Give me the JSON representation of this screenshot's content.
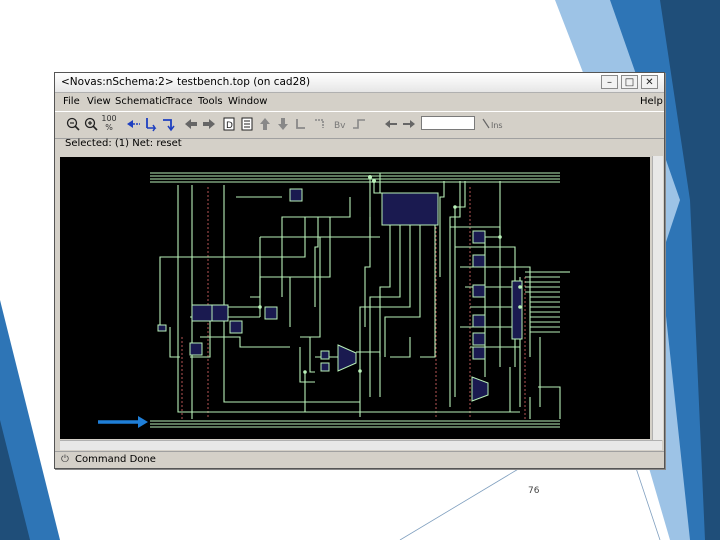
{
  "window": {
    "title": "<Novas:nSchema:2> testbench.top (on cad28)",
    "controls": [
      "–",
      "□",
      "✕"
    ]
  },
  "menu": {
    "file": "File",
    "view": "View",
    "schematic": "Schematic",
    "trace": "Trace",
    "tools": "Tools",
    "window": "Window",
    "help": "Help"
  },
  "toolbar": {
    "zoom_level": "100",
    "zoom_unit": "%",
    "find_placeholder": "",
    "tool_icons": [
      "zoom-out-icon",
      "zoom-in-icon",
      "zoom-fit-icon",
      "trace-driver-icon",
      "trace-load-icon",
      "trace-connect-icon",
      "back-icon",
      "forward-icon",
      "hierarchy-icon",
      "push-icon",
      "up-icon",
      "down-icon",
      "undo-icon",
      "redo-icon",
      "bus-icon",
      "signal-icon",
      "find-prev-icon",
      "find-next-icon",
      "find-icon"
    ]
  },
  "selection": {
    "text": "Selected: (1) Net: reset"
  },
  "status": {
    "text": "Command Done"
  },
  "slide": {
    "page_number": "76",
    "accent_colors": [
      "#1f4e79",
      "#2e75b6",
      "#9dc3e6"
    ]
  },
  "schematic": {
    "background": "#000000",
    "wire_color": "#b8f0b8",
    "cell_color": "#1a1a50",
    "arrow_color": "#1f7fd8"
  }
}
